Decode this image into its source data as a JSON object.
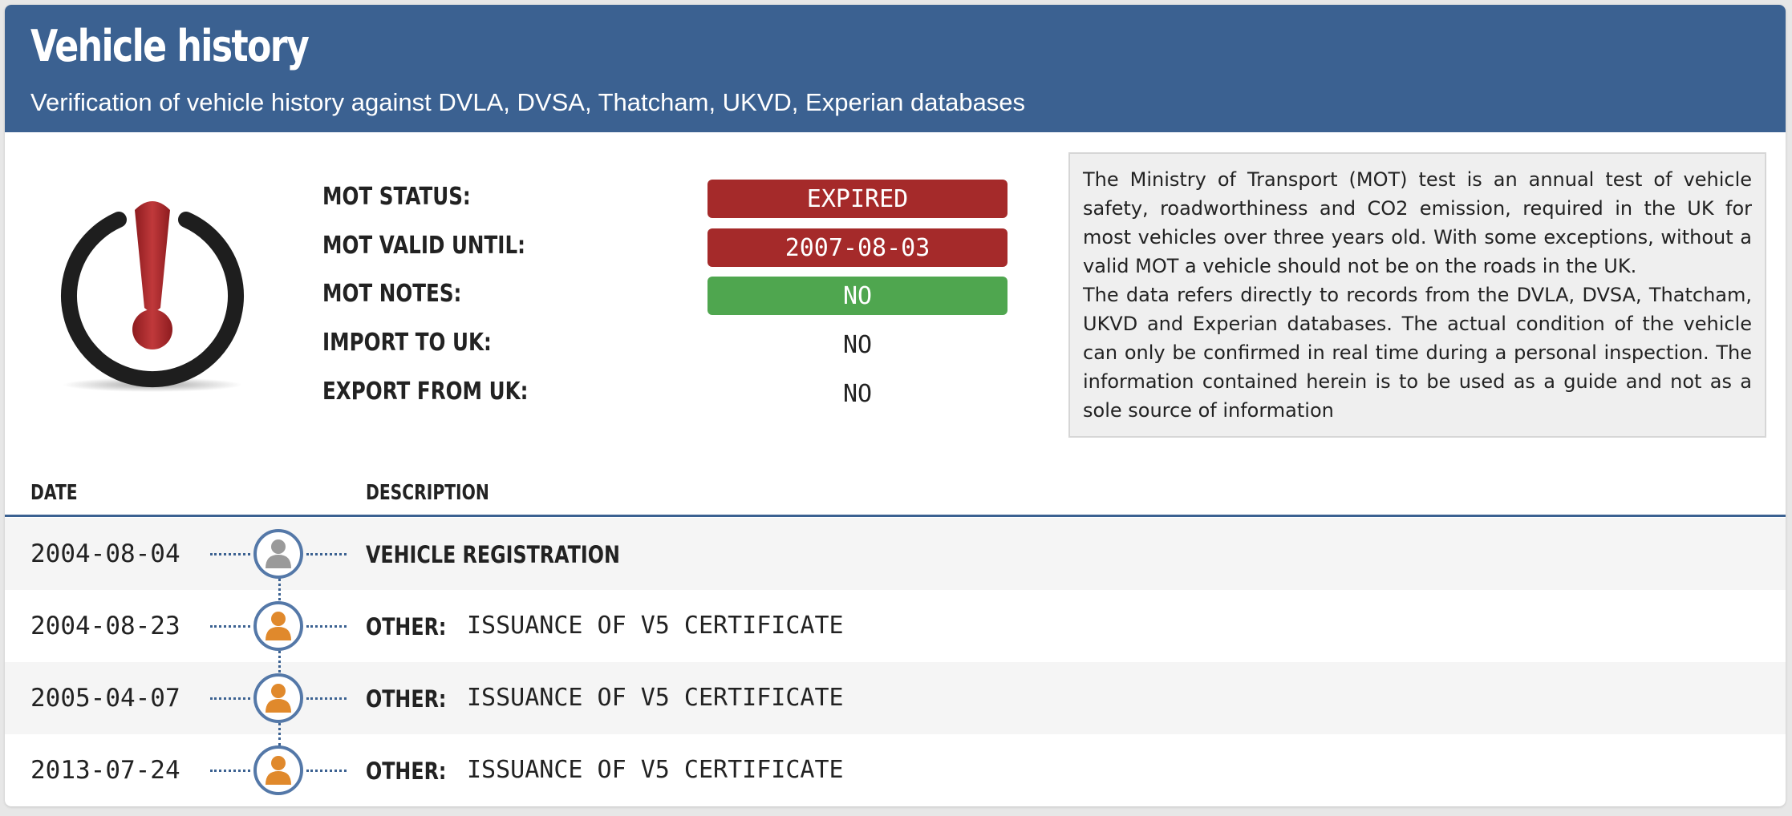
{
  "header": {
    "title": "Vehicle history",
    "subtitle": "Verification of vehicle history against DVLA, DVSA, Thatcham, UKVD, Experian databases"
  },
  "status_icon": "exclamation-alert-icon",
  "status": [
    {
      "label": "MOT STATUS:",
      "value": "EXPIRED",
      "color": "#a52a2a"
    },
    {
      "label": "MOT VALID UNTIL:",
      "value": "2007-08-03",
      "color": "#a52a2a"
    },
    {
      "label": "MOT NOTES:",
      "value": "NO",
      "color": "#4fa64f"
    },
    {
      "label": "IMPORT TO UK:",
      "value": "NO"
    },
    {
      "label": "EXPORT FROM UK:",
      "value": "NO"
    }
  ],
  "info": {
    "paragraph1": "The Ministry of Transport (MOT) test is an annual test of vehicle safety, roadworthiness and CO2 emission, required in the UK for most vehicles over three years old. With some exceptions, without a valid MOT a vehicle should not be on the roads in the UK.",
    "paragraph2": "The data refers directly to records from the DVLA, DVSA, Thatcham, UKVD and Experian databases. The actual condition of the vehicle can only be confirmed in real time during a personal inspection. The information contained herein is to be used as a guide and not as a sole source of information"
  },
  "history": {
    "columns": {
      "date": "DATE",
      "description": "DESCRIPTION"
    },
    "rows": [
      {
        "date": "2004-08-04",
        "kind": "VEHICLE REGISTRATION",
        "description": "",
        "icon": "user-gray-icon"
      },
      {
        "date": "2004-08-23",
        "kind": "OTHER:",
        "description": "ISSUANCE OF V5 CERTIFICATE",
        "icon": "user-orange-icon"
      },
      {
        "date": "2005-04-07",
        "kind": "OTHER:",
        "description": "ISSUANCE OF V5 CERTIFICATE",
        "icon": "user-orange-icon"
      },
      {
        "date": "2013-07-24",
        "kind": "OTHER:",
        "description": "ISSUANCE OF V5 CERTIFICATE",
        "icon": "user-orange-icon"
      }
    ]
  },
  "colors": {
    "header": "#3b6191",
    "expired": "#a52a2a",
    "ok": "#4fa64f",
    "user_gray": "#9a9a9a",
    "user_orange": "#e0892c"
  }
}
